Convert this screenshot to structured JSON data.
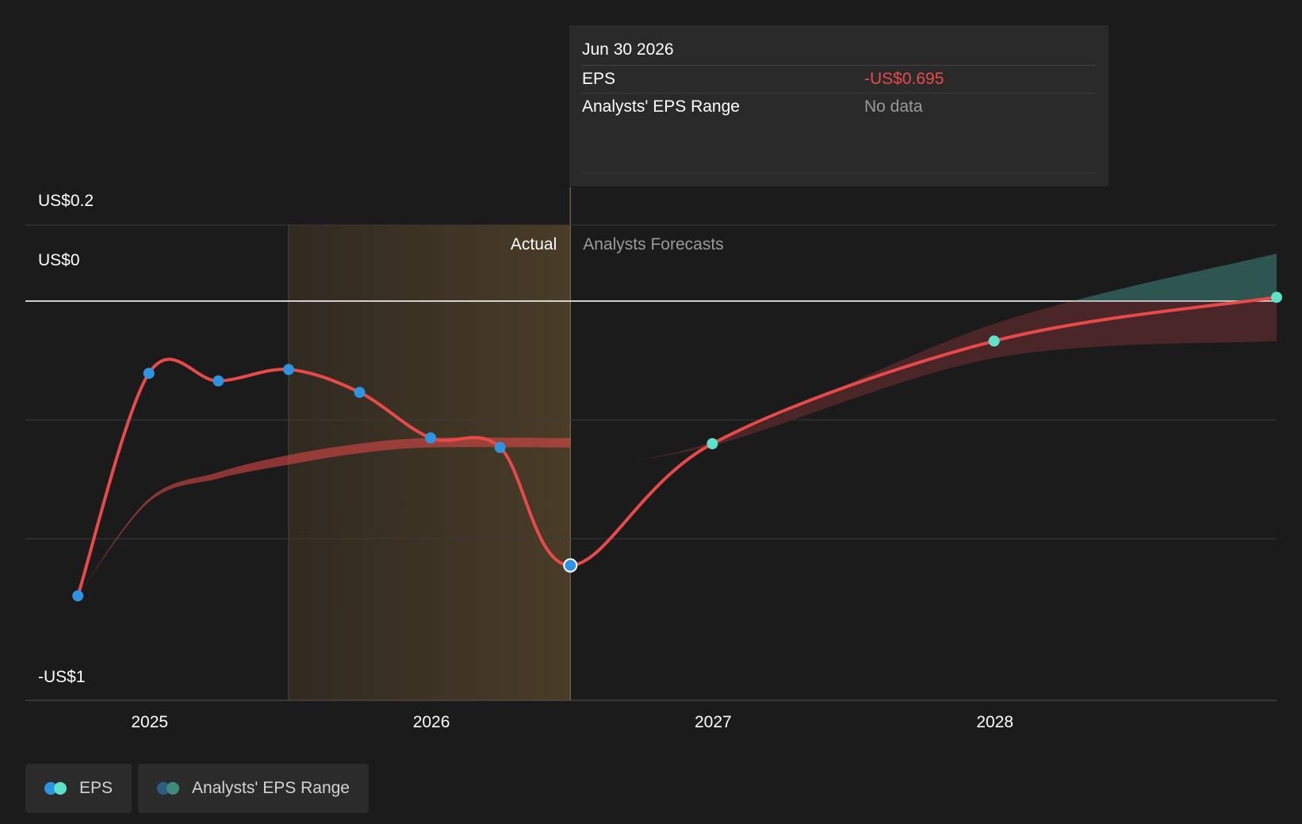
{
  "tooltip": {
    "date": "Jun 30 2026",
    "rows": [
      {
        "label": "EPS",
        "value": "-US$0.695"
      },
      {
        "label": "Analysts' EPS Range",
        "value": "No data"
      }
    ]
  },
  "legend": {
    "items": [
      {
        "label": "EPS",
        "colors": [
          "#2f94e0",
          "#5fe0c8"
        ]
      },
      {
        "label": "Analysts' EPS Range",
        "colors": [
          "#2a5e82",
          "#3f8a7d"
        ]
      }
    ]
  },
  "colors": {
    "background": "#1b1b1b",
    "eps_line": "#e84a4a",
    "actual_point": "#2f94e0",
    "forecast_point": "#5fe0c8",
    "actual_band": "#4a3c28",
    "forecast_range_above_zero": "#2f5550",
    "forecast_range_below_zero": "#4a2628"
  },
  "chart_data": {
    "type": "line",
    "region_labels": {
      "actual": "Actual",
      "forecast": "Analysts Forecasts"
    },
    "y_tick_labels": [
      {
        "value": 0.2,
        "label": "US$0.2"
      },
      {
        "value": 0,
        "label": "US$0"
      },
      {
        "value": -1,
        "label": "-US$1"
      }
    ],
    "x_tick_labels": [
      {
        "date": "2025-01-01",
        "label": "2025"
      },
      {
        "date": "2026-01-01",
        "label": "2026"
      },
      {
        "date": "2027-01-01",
        "label": "2027"
      },
      {
        "date": "2028-01-01",
        "label": "2028"
      }
    ],
    "xlim": [
      "2024-07-24",
      "2028-12-31"
    ],
    "ylim": [
      -1.05,
      0.2
    ],
    "grid_values": [
      0.2,
      -0.3125,
      -0.625
    ],
    "highlight_range": [
      "2025-06-30",
      "2026-06-30"
    ],
    "current_date": "2026-06-30",
    "series": [
      {
        "name": "EPS",
        "points": [
          {
            "date": "2024-09-30",
            "value": -0.775,
            "kind": "actual"
          },
          {
            "date": "2024-12-31",
            "value": -0.19,
            "kind": "actual"
          },
          {
            "date": "2025-03-31",
            "value": -0.21,
            "kind": "actual"
          },
          {
            "date": "2025-06-30",
            "value": -0.18,
            "kind": "actual"
          },
          {
            "date": "2025-09-30",
            "value": -0.24,
            "kind": "actual"
          },
          {
            "date": "2025-12-31",
            "value": -0.36,
            "kind": "actual"
          },
          {
            "date": "2026-03-31",
            "value": -0.385,
            "kind": "actual"
          },
          {
            "date": "2026-06-30",
            "value": -0.695,
            "kind": "actual",
            "selected": true
          },
          {
            "date": "2026-12-31",
            "value": -0.375,
            "kind": "forecast"
          },
          {
            "date": "2027-12-31",
            "value": -0.105,
            "kind": "forecast"
          },
          {
            "date": "2028-12-31",
            "value": 0.01,
            "kind": "forecast"
          }
        ]
      }
    ],
    "historical_estimate_band": [
      {
        "date": "2024-09-30",
        "value": -0.775
      },
      {
        "date": "2024-12-31",
        "value": -0.52
      },
      {
        "date": "2025-03-31",
        "value": -0.45
      },
      {
        "date": "2025-06-30",
        "value": -0.405
      },
      {
        "date": "2025-09-30",
        "value": -0.375
      },
      {
        "date": "2025-12-31",
        "value": -0.36
      },
      {
        "date": "2026-06-30",
        "value": -0.36
      }
    ],
    "analyst_range": [
      {
        "date": "2026-06-30",
        "low": -0.435,
        "high": -0.435
      },
      {
        "date": "2026-12-31",
        "low": -0.38,
        "high": -0.37
      },
      {
        "date": "2027-12-31",
        "low": -0.15,
        "high": -0.06
      },
      {
        "date": "2028-12-31",
        "low": -0.105,
        "high": 0.125
      }
    ]
  }
}
